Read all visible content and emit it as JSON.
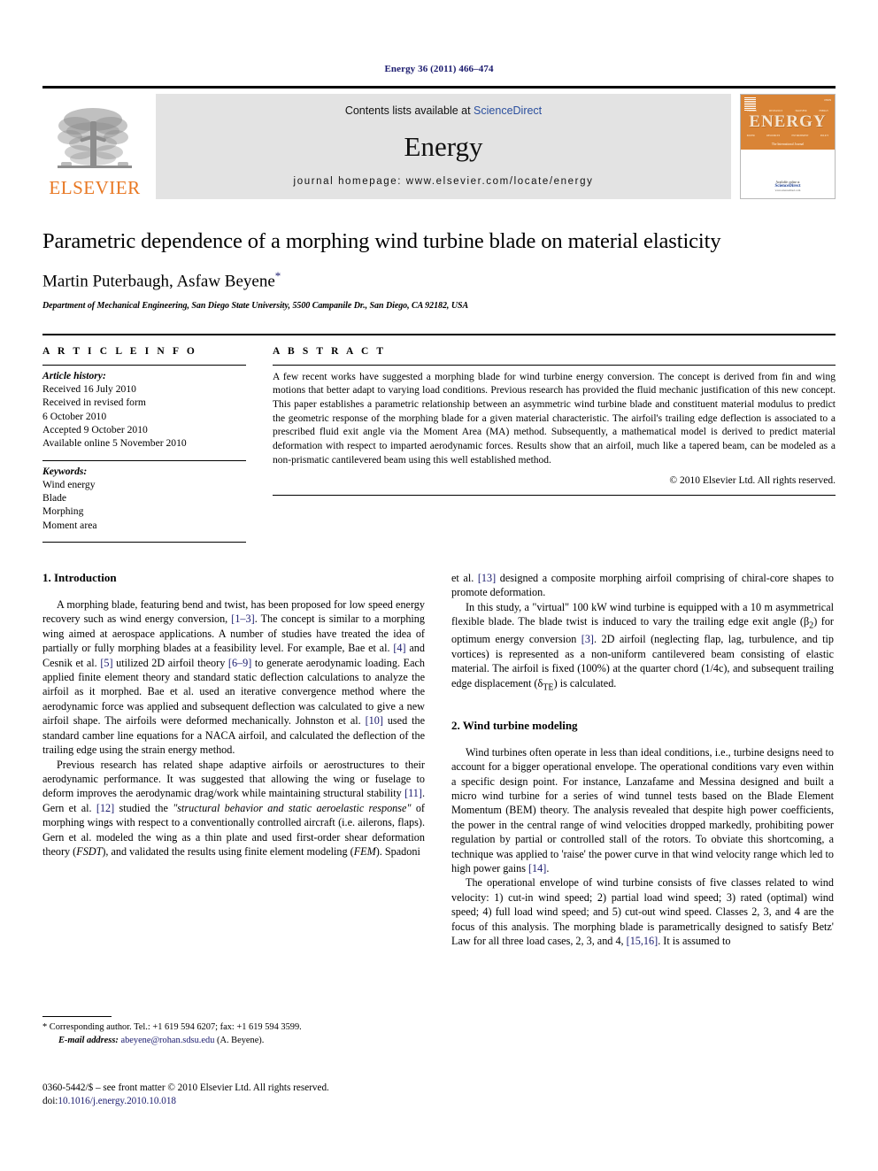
{
  "running_head": "Energy 36 (2011) 466–474",
  "banner": {
    "contents_prefix": "Contents lists available at ",
    "sciencedirect": "ScienceDirect",
    "journal_name": "Energy",
    "homepage": "journal homepage: www.elsevier.com/locate/energy",
    "publisher_wordmark": "ELSEVIER",
    "publisher_logo_icon": "elsevier-tree-icon",
    "cover": {
      "title": "ENERGY",
      "subtitle": "The International Journal",
      "available_at": "Available online at",
      "provider": "ScienceDirect",
      "url": "www.sciencedirect.com",
      "topics_row1": [
        "THERMODYNAMICS",
        "MECHANICS",
        "HEAT TRANSFER",
        "ENERGY"
      ],
      "topics_row2": [
        "POWER",
        "RESOURCES",
        "ENVIRONMENT",
        "MANAGEMENT",
        "POLICY"
      ]
    }
  },
  "article": {
    "title": "Parametric dependence of a morphing wind turbine blade on material elasticity",
    "authors": "Martin Puterbaugh, Asfaw Beyene",
    "corresponding_marker": "*",
    "affiliation": "Department of Mechanical Engineering, San Diego State University, 5500 Campanile Dr., San Diego, CA 92182, USA"
  },
  "article_info": {
    "heading": "A R T I C L E   I N F O",
    "history_label": "Article history:",
    "history": [
      "Received 16 July 2010",
      "Received in revised form",
      "6 October 2010",
      "Accepted 9 October 2010",
      "Available online 5 November 2010"
    ],
    "keywords_label": "Keywords:",
    "keywords": [
      "Wind energy",
      "Blade",
      "Morphing",
      "Moment area"
    ]
  },
  "abstract": {
    "heading": "A B S T R A C T",
    "text": "A few recent works have suggested a morphing blade for wind turbine energy conversion. The concept is derived from fin and wing motions that better adapt to varying load conditions. Previous research has provided the fluid mechanic justification of this new concept. This paper establishes a parametric relationship between an asymmetric wind turbine blade and constituent material modulus to predict the geometric response of the morphing blade for a given material characteristic. The airfoil's trailing edge deflection is associated to a prescribed fluid exit angle via the Moment Area (MA) method. Subsequently, a mathematical model is derived to predict material deformation with respect to imparted aerodynamic forces. Results show that an airfoil, much like a tapered beam, can be modeled as a non-prismatic cantilevered beam using this well established method.",
    "copyright": "© 2010 Elsevier Ltd. All rights reserved."
  },
  "sections": {
    "intro_heading": "1. Introduction",
    "intro_p1_a": "A morphing blade, featuring bend and twist, has been proposed for low speed energy recovery such as wind energy conversion, ",
    "intro_p1_c1": "[1–3]",
    "intro_p1_b": ". The concept is similar to a morphing wing aimed at aerospace applications. A number of studies have treated the idea of partially or fully morphing blades at a feasibility level. For example, Bae et al. ",
    "intro_p1_c2": "[4]",
    "intro_p1_d": " and Cesnik et al. ",
    "intro_p1_c3": "[5]",
    "intro_p1_e": " utilized 2D airfoil theory ",
    "intro_p1_c4": "[6–9]",
    "intro_p1_f": " to generate aerodynamic loading. Each applied finite element theory and standard static deflection calculations to analyze the airfoil as it morphed. Bae et al. used an iterative convergence method where the aerodynamic force was applied and subsequent deflection was calculated to give a new airfoil shape. The airfoils were deformed mechanically. Johnston et al. ",
    "intro_p1_c5": "[10]",
    "intro_p1_g": " used the standard camber line equations for a NACA airfoil, and calculated the deflection of the trailing edge using the strain energy method.",
    "intro_p2_a": "Previous research has related shape adaptive airfoils or aerostructures to their aerodynamic performance. It was suggested that allowing the wing or fuselage to deform improves the aerodynamic drag/work while maintaining structural stability ",
    "intro_p2_c1": "[11]",
    "intro_p2_b": ". Gern et al. ",
    "intro_p2_c2": "[12]",
    "intro_p2_c": " studied the ",
    "intro_p2_quote": "\"structural behavior and static aeroelastic response\"",
    "intro_p2_d": " of morphing wings with respect to a conventionally controlled aircraft (i.e. ailerons, flaps). Gern et al. modeled the wing as a thin plate and used first-order shear deformation theory (",
    "intro_p2_fsdt": "FSDT",
    "intro_p2_e": "), and validated the results using finite element modeling (",
    "intro_p2_fem": "FEM",
    "intro_p2_f": "). Spadoni",
    "intro_p3_a": "et al. ",
    "intro_p3_c1": "[13]",
    "intro_p3_b": " designed a composite morphing airfoil comprising of chiral-core shapes to promote deformation.",
    "intro_p4_a": "In this study, a \"virtual\" 100 kW wind turbine is equipped with a 10 m asymmetrical flexible blade. The blade twist is induced to vary the trailing edge exit angle (β",
    "intro_p4_sub1": "2",
    "intro_p4_b": ") for optimum energy conversion ",
    "intro_p4_c1": "[3]",
    "intro_p4_c": ". 2D airfoil (neglecting flap, lag, turbulence, and tip vortices) is represented as a non-uniform cantilevered beam consisting of elastic material. The airfoil is fixed (100%) at the quarter chord (1/4c), and subsequent trailing edge displacement (δ",
    "intro_p4_sub2": "TE",
    "intro_p4_d": ") is calculated.",
    "wtm_heading": "2. Wind turbine modeling",
    "wtm_p1_a": "Wind turbines often operate in less than ideal conditions, i.e., turbine designs need to account for a bigger operational envelope. The operational conditions vary even within a specific design point. For instance, Lanzafame and Messina designed and built a micro wind turbine for a series of wind tunnel tests based on the Blade Element Momentum (BEM) theory. The analysis revealed that despite high power coefficients, the power in the central range of wind velocities dropped markedly, prohibiting power regulation by partial or controlled stall of the rotors. To obviate this shortcoming, a technique was applied to 'raise' the power curve in that wind velocity range which led to high power gains ",
    "wtm_p1_c1": "[14]",
    "wtm_p1_b": ".",
    "wtm_p2_a": "The operational envelope of wind turbine consists of five classes related to wind velocity: 1) cut-in wind speed; 2) partial load wind speed; 3) rated (optimal) wind speed; 4) full load wind speed; and 5) cut-out wind speed. Classes 2, 3, and 4 are the focus of this analysis. The morphing blade is parametrically designed to satisfy Betz' Law for all three load cases, 2, 3, and 4, ",
    "wtm_p2_c1": "[15,16]",
    "wtm_p2_b": ". It is assumed to"
  },
  "footnote": {
    "marker": "*",
    "corresponding": " Corresponding author. Tel.: +1 619 594 6207; fax: +1 619 594 3599.",
    "email_label": "E-mail address:",
    "email": "abeyene@rohan.sdsu.edu",
    "email_suffix": " (A. Beyene)."
  },
  "footer": {
    "issn_line": "0360-5442/$ – see front matter © 2010 Elsevier Ltd. All rights reserved.",
    "doi_label": "doi:",
    "doi": "10.1016/j.energy.2010.10.018"
  },
  "colors": {
    "link_blue": "#1a1a6e",
    "sciencedirect_blue": "#2b4f9e",
    "elsevier_orange": "#E87722",
    "banner_gray": "#e3e3e3",
    "cover_orange": "#d98436"
  }
}
